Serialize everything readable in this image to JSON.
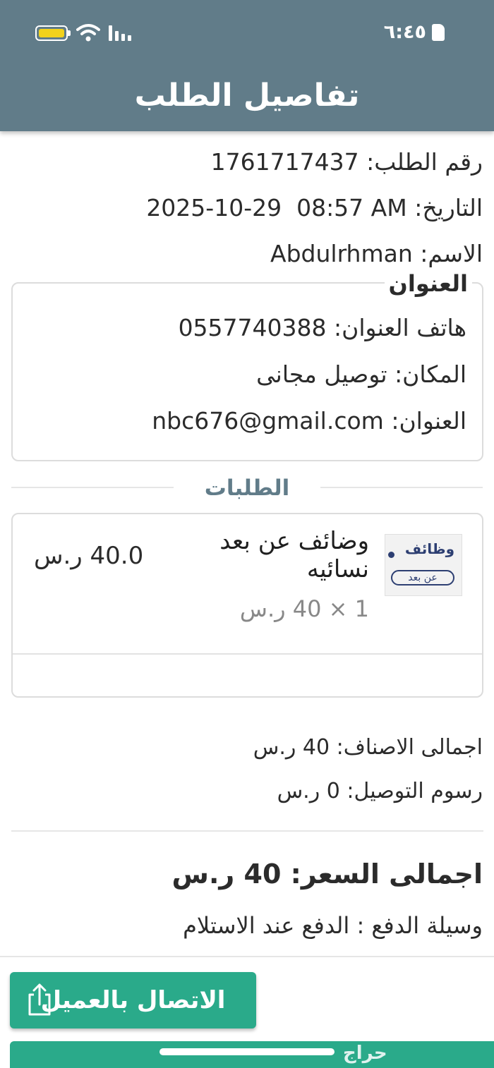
{
  "status_bar": {
    "time": "٦:٤٥"
  },
  "header": {
    "title": "تفاصيل الطلب"
  },
  "order_info": {
    "number_label": "رقم الطلب:",
    "number_value": "1761717437",
    "date_label": "التاريخ:",
    "date_value": "2025-10-29  08:57 AM",
    "name_label": "الاسم:",
    "name_value": "Abdulrhman"
  },
  "address": {
    "legend": "العنوان",
    "phone_label": "هاتف العنوان:",
    "phone_value": "0557740388",
    "place_label": "المكان:",
    "place_value": "توصيل مجانى",
    "address_label": "العنوان:",
    "address_value": "nbc676@gmail.com"
  },
  "orders": {
    "section_title": "الطلبات",
    "items": [
      {
        "name": "وضائف عن بعد نسائيه",
        "qty_line": "1 × 40 ر.س",
        "price": "40.0 ر.س",
        "thumb_line1": "وظائف",
        "thumb_line2": "عن بعد"
      }
    ]
  },
  "summary": {
    "items_total": "اجمالى الاصناف: 40 ر.س",
    "delivery_fee": "رسوم التوصيل: 0 ر.س",
    "grand_total": "اجمالى السعر: 40 ر.س",
    "payment_method": "وسيلة الدفع : الدفع عند الاستلام"
  },
  "actions": {
    "contact_customer": "الاتصال بالعميل"
  },
  "watermark": "حراج",
  "colors": {
    "header": "#617c89",
    "accent": "#2aaa8a",
    "thumb_text": "#2d3f72"
  }
}
